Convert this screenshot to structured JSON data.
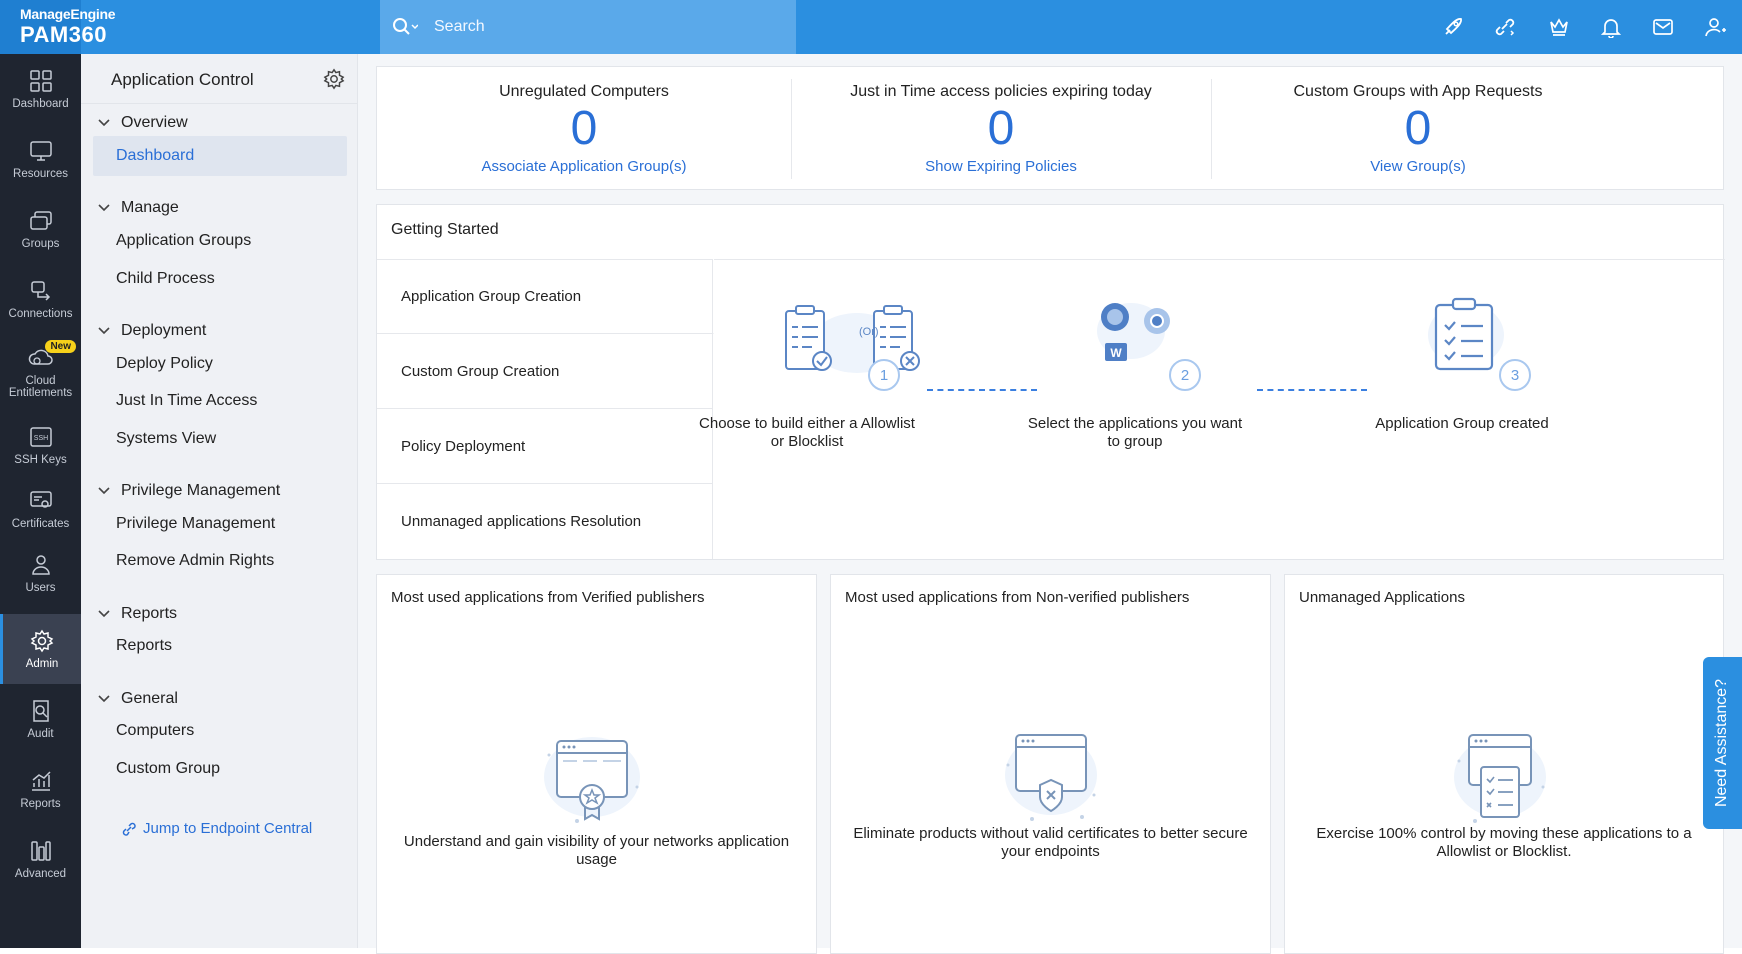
{
  "brand": {
    "line1": "ManageEngine",
    "line2": "PAM360"
  },
  "search": {
    "placeholder": "Search"
  },
  "topbar_icons": [
    "rocket-icon",
    "link-icon",
    "crown-icon",
    "bell-icon",
    "mail-icon",
    "user-settings-icon"
  ],
  "leftnav": [
    {
      "label": "Dashboard",
      "icon": "dashboard-icon"
    },
    {
      "label": "Resources",
      "icon": "monitor-icon"
    },
    {
      "label": "Groups",
      "icon": "groups-icon"
    },
    {
      "label": "Connections",
      "icon": "connections-icon"
    },
    {
      "label": "Cloud Entitlements",
      "icon": "cloud-icon",
      "badge": "New"
    },
    {
      "label": "SSH Keys",
      "icon": "ssh-icon"
    },
    {
      "label": "Certificates",
      "icon": "certificate-icon"
    },
    {
      "label": "Users",
      "icon": "user-icon"
    },
    {
      "label": "Admin",
      "icon": "gear-icon",
      "active": true
    },
    {
      "label": "Audit",
      "icon": "audit-icon"
    },
    {
      "label": "Reports",
      "icon": "chart-icon"
    },
    {
      "label": "Advanced",
      "icon": "advanced-icon"
    }
  ],
  "subnav": {
    "title": "Application Control",
    "sections": [
      {
        "label": "Overview",
        "items": [
          "Dashboard"
        ]
      },
      {
        "label": "Manage",
        "items": [
          "Application Groups",
          "Child Process"
        ]
      },
      {
        "label": "Deployment",
        "items": [
          "Deploy Policy",
          "Just In Time Access",
          "Systems View"
        ]
      },
      {
        "label": "Privilege Management",
        "items": [
          "Privilege Management",
          "Remove Admin Rights"
        ]
      },
      {
        "label": "Reports",
        "items": [
          "Reports"
        ]
      },
      {
        "label": "General",
        "items": [
          "Computers",
          "Custom Group"
        ]
      }
    ],
    "active_item": "Dashboard",
    "jump": "Jump to Endpoint Central"
  },
  "stats": [
    {
      "label": "Unregulated Computers",
      "value": "0",
      "link": "Associate Application Group(s)"
    },
    {
      "label": "Just in Time access policies expiring today",
      "value": "0",
      "link": "Show Expiring Policies"
    },
    {
      "label": "Custom Groups with App Requests",
      "value": "0",
      "link": "View Group(s)"
    }
  ],
  "getting_started": {
    "title": "Getting Started",
    "tabs": [
      "Application Group Creation",
      "Custom Group Creation",
      "Policy Deployment",
      "Unmanaged applications Resolution"
    ],
    "or_label": "(Or)",
    "steps": [
      {
        "num": "1",
        "text": "Choose to build either a Allowlist or Blocklist"
      },
      {
        "num": "2",
        "text": "Select the applications you want to group"
      },
      {
        "num": "3",
        "text": "Application Group created"
      }
    ]
  },
  "bottom_cards": [
    {
      "title": "Most used applications from Verified publishers",
      "desc": "Understand and gain visibility of your networks application usage"
    },
    {
      "title": "Most used applications from Non-verified publishers",
      "desc": "Eliminate products without valid certificates to better secure your endpoints"
    },
    {
      "title": "Unmanaged Applications",
      "desc": "Exercise 100% control by moving these applications to a Allowlist or Blocklist."
    }
  ],
  "assist": "Need Assistance?",
  "colors": {
    "topbar": "#2b8fe0",
    "sidebar": "#1f2530",
    "accent": "#2a6fd6"
  }
}
